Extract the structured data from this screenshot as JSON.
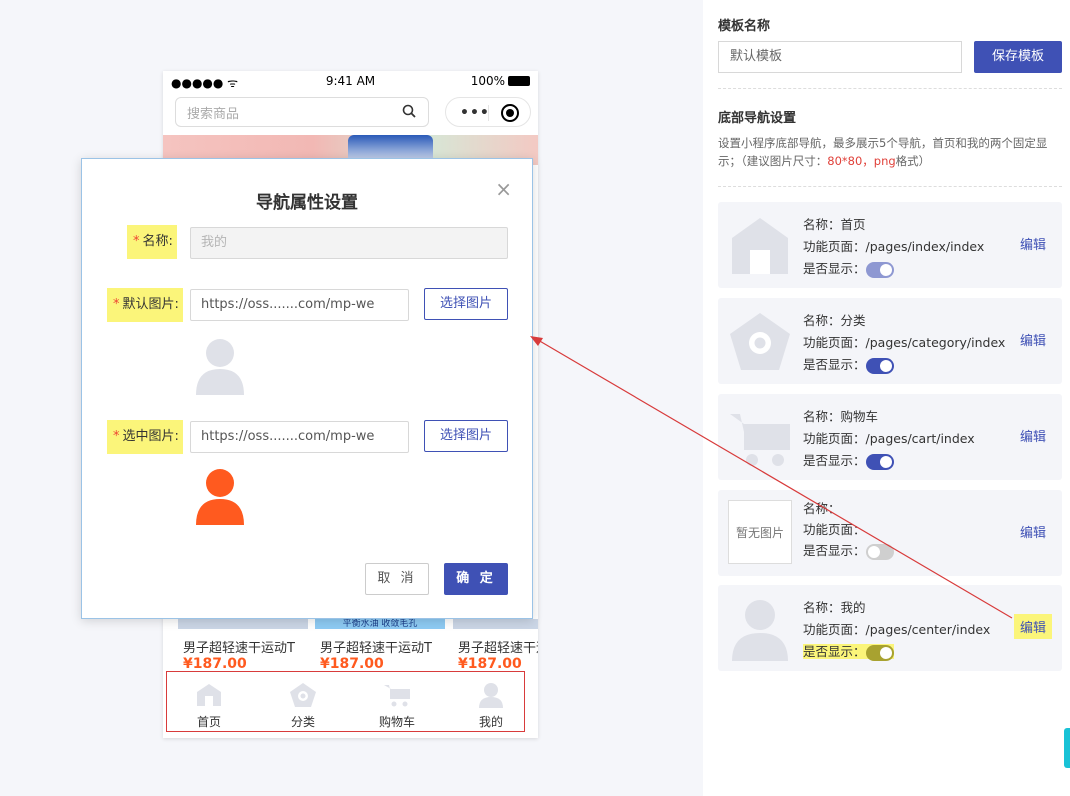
{
  "phone": {
    "status_time": "9:41 AM",
    "status_battery": "100%",
    "search_placeholder": "搜索商品",
    "capsule_dots": "•••",
    "products": [
      {
        "name": "男子超轻速干运动T",
        "price": "¥187.00",
        "tag": ""
      },
      {
        "name": "男子超轻速干运动T",
        "price": "¥187.00",
        "tag": "平衡水油 收敛毛孔"
      },
      {
        "name": "男子超轻速干运动T",
        "price": "¥187.00",
        "tag": ""
      }
    ],
    "tabbar": [
      {
        "label": "首页",
        "icon": "home-icon"
      },
      {
        "label": "分类",
        "icon": "category-icon"
      },
      {
        "label": "购物车",
        "icon": "cart-icon"
      },
      {
        "label": "我的",
        "icon": "user-icon"
      }
    ]
  },
  "modal": {
    "title": "导航属性设置",
    "close": "×",
    "name_label": "名称:",
    "name_value": "我的",
    "default_image_label": "默认图片:",
    "default_image_url": "https://oss.......com/mp-we",
    "selected_image_label": "选中图片:",
    "selected_image_url": "https://oss.......com/mp-we",
    "choose_image": "选择图片",
    "cancel": "取 消",
    "confirm": "确 定",
    "required_mark": "*"
  },
  "panel": {
    "template_name_heading": "模板名称",
    "template_name_value": "默认模板",
    "save_button": "保存模板",
    "nav_heading": "底部导航设置",
    "nav_desc_1": "设置小程序底部导航，最多展示5个导航，首页和我的两个固定显示；（建议图片尺寸：",
    "nav_desc_red": "80*80，png",
    "nav_desc_2": "格式）",
    "name_prefix": "名称：",
    "page_prefix": "功能页面：",
    "show_prefix": "是否显示：",
    "edit": "编辑",
    "no_image": "暂无图片",
    "items": [
      {
        "name": "首页",
        "page": "/pages/index/index",
        "show": true,
        "icon": "home-icon"
      },
      {
        "name": "分类",
        "page": "/pages/category/index",
        "show": true,
        "icon": "category-icon"
      },
      {
        "name": "购物车",
        "page": "/pages/cart/index",
        "show": true,
        "icon": "cart-icon"
      },
      {
        "name": "",
        "page": "",
        "show": false,
        "icon": "no-image"
      },
      {
        "name": "我的",
        "page": "/pages/center/index",
        "show": true,
        "icon": "user-icon"
      }
    ]
  },
  "colors": {
    "accent": "#3f51b5",
    "highlight": "#fbf57a",
    "avatar_selected": "#ff5a1f",
    "icon_gray": "#dfe1e8",
    "annotation_red": "#d83b3b"
  }
}
